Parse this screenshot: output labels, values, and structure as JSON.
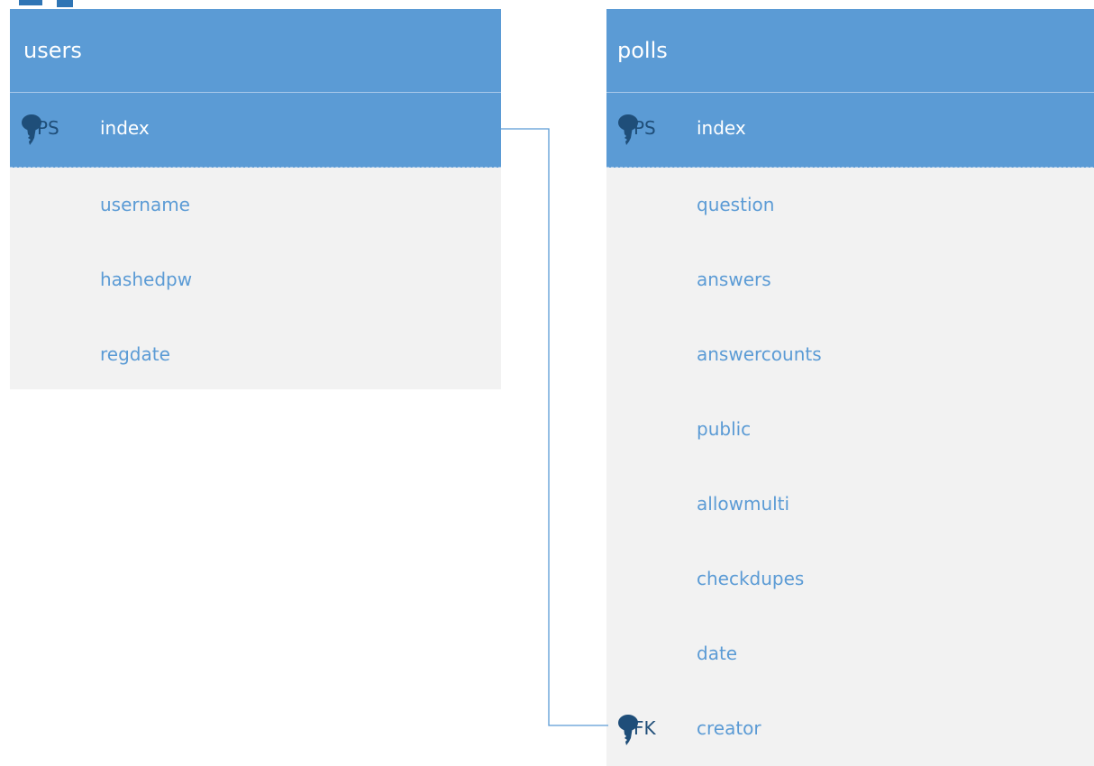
{
  "users_table": {
    "name": "users",
    "primary_key": {
      "badge": "PS",
      "name": "index"
    },
    "fields": [
      "username",
      "hashedpw",
      "regdate"
    ]
  },
  "polls_table": {
    "name": "polls",
    "primary_key": {
      "badge": "PS",
      "name": "index"
    },
    "fields": [
      "question",
      "answers",
      "answercounts",
      "public",
      "allowmulti",
      "checkdupes",
      "date"
    ],
    "foreign_key": {
      "badge": "FK",
      "name": "creator"
    }
  },
  "colors": {
    "header": "#5b9bd5",
    "body": "#f2f2f2",
    "field_text": "#5b9bd5",
    "key_icon": "#1f4e79",
    "connector": "#5b9bd5"
  },
  "icons": {
    "key": "key-icon"
  }
}
